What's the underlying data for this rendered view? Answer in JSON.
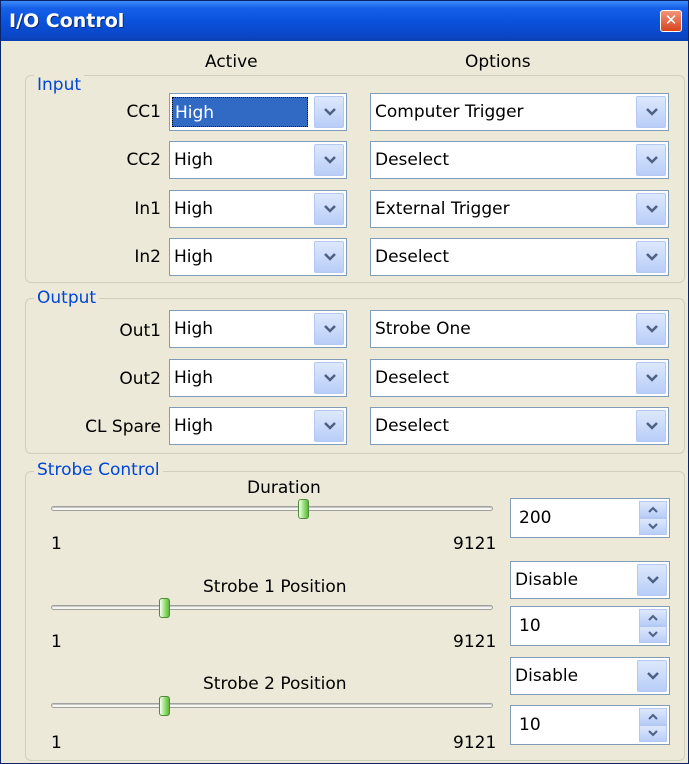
{
  "window": {
    "title": "I/O Control"
  },
  "columns": {
    "active": "Active",
    "options": "Options"
  },
  "input": {
    "legend": "Input",
    "rows": [
      {
        "label": "CC1",
        "active": "High",
        "option": "Computer Trigger"
      },
      {
        "label": "CC2",
        "active": "High",
        "option": "Deselect"
      },
      {
        "label": "In1",
        "active": "High",
        "option": "External Trigger"
      },
      {
        "label": "In2",
        "active": "High",
        "option": "Deselect"
      }
    ]
  },
  "output": {
    "legend": "Output",
    "rows": [
      {
        "label": "Out1",
        "active": "High",
        "option": "Strobe One"
      },
      {
        "label": "Out2",
        "active": "High",
        "option": "Deselect"
      },
      {
        "label": "CL Spare",
        "active": "High",
        "option": "Deselect"
      }
    ]
  },
  "strobe": {
    "legend": "Strobe Control",
    "duration": {
      "label": "Duration",
      "min": "1",
      "max": "9121",
      "value": "200",
      "slider_fraction": 0.54
    },
    "strobe1": {
      "label": "Strobe 1 Position",
      "min": "1",
      "max": "9121",
      "mode": "Disable",
      "value": "10",
      "slider_fraction": 0.22
    },
    "strobe2": {
      "label": "Strobe 2 Position",
      "min": "1",
      "max": "9121",
      "mode": "Disable",
      "value": "10",
      "slider_fraction": 0.22
    }
  },
  "icons": {
    "close": "close-icon",
    "dropdown": "chevron-down-icon",
    "spin_up": "arrow-up-icon",
    "spin_down": "arrow-down-icon"
  }
}
